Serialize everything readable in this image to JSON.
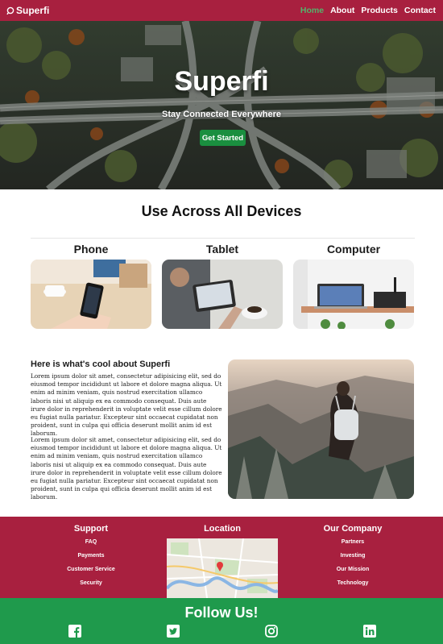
{
  "nav": {
    "brand": "Superfi",
    "links": [
      "Home",
      "About",
      "Products",
      "Contact"
    ],
    "active_color": "#53b46b"
  },
  "hero": {
    "title": "Superfi",
    "subtitle": "Stay Connected Everywhere",
    "cta": "Get Started"
  },
  "devices": {
    "title": "Use Across All Devices",
    "items": [
      "Phone",
      "Tablet",
      "Computer"
    ]
  },
  "feature": {
    "title": "Here is what's cool about Superfi",
    "paragraphs": [
      "Lorem ipsum dolor sit amet, consectetur adipisicing elit, sed do eiusmod tempor incididunt ut labore et dolore magna aliqua. Ut enim ad minim veniam, quis nostrud exercitation ullamco laboris nisi ut aliquip ex ea commodo consequat. Duis aute irure dolor in reprehenderit in voluptate velit esse cillum dolore eu fugiat nulla pariatur. Excepteur sint occaecat cupidatat non proident, sunt in culpa qui officia deserunt mollit anim id est laborum.",
      "Lorem ipsum dolor sit amet, consectetur adipisicing elit, sed do eiusmod tempor incididunt ut labore et dolore magna aliqua. Ut enim ad minim veniam, quis nostrud exercitation ullamco laboris nisi ut aliquip ex ea commodo consequat. Duis aute irure dolor in reprehenderit in voluptate velit esse cillum dolore eu fugiat nulla pariatur. Excepteur sint occaecat cupidatat non proident, sunt in culpa qui officia deserunt mollit anim id est laborum."
    ]
  },
  "footer": {
    "support": {
      "title": "Support",
      "items": [
        "FAQ",
        "Payments",
        "Customer Service",
        "Security"
      ]
    },
    "location": {
      "title": "Location"
    },
    "company": {
      "title": "Our Company",
      "items": [
        "Partners",
        "Investing",
        "Our Mission",
        "Technology"
      ]
    }
  },
  "follow": {
    "title": "Follow Us!",
    "icons": [
      "facebook-icon",
      "twitter-icon",
      "instagram-icon",
      "linkedin-icon"
    ]
  },
  "colors": {
    "brand_red": "#a8203f",
    "brand_green": "#1f9a4c",
    "button_green": "#1a8f3f"
  }
}
